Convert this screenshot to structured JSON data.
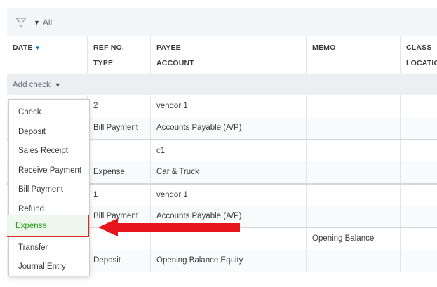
{
  "filter": {
    "value": "All"
  },
  "columns": {
    "date": "DATE",
    "ref_no": "REF NO.",
    "type": "TYPE",
    "payee": "PAYEE",
    "account": "ACCOUNT",
    "memo": "MEMO",
    "class": "CLASS",
    "location": "LOCATION"
  },
  "add_check": {
    "label": "Add check"
  },
  "transactions": [
    {
      "ref_no": "2",
      "type": "Bill Payment",
      "payee": "vendor 1",
      "account": "Accounts Payable (A/P)",
      "memo": ""
    },
    {
      "ref_no": "",
      "type": "Expense",
      "payee": "c1",
      "account": "Car & Truck",
      "memo": ""
    },
    {
      "ref_no": "1",
      "type": "Bill Payment",
      "payee": "vendor 1",
      "account": "Accounts Payable (A/P)",
      "memo": ""
    },
    {
      "ref_no": "",
      "type": "Deposit",
      "payee": "",
      "account": "Opening Balance Equity",
      "memo": "Opening Balance"
    }
  ],
  "dropdown": {
    "items": [
      "Check",
      "Deposit",
      "Sales Receipt",
      "Receive Payment",
      "Bill Payment",
      "Refund",
      "Expense",
      "Transfer",
      "Journal Entry"
    ],
    "highlighted": "Expense"
  },
  "colors": {
    "accent_blue": "#0077c5",
    "highlight_green": "#2ca01c",
    "annotation_red": "#e8141b"
  },
  "icons": {
    "filter": "funnel-icon",
    "sort": "sort-down-icon",
    "dropdown": "caret-down-icon",
    "annotation": "red-arrow-left"
  }
}
